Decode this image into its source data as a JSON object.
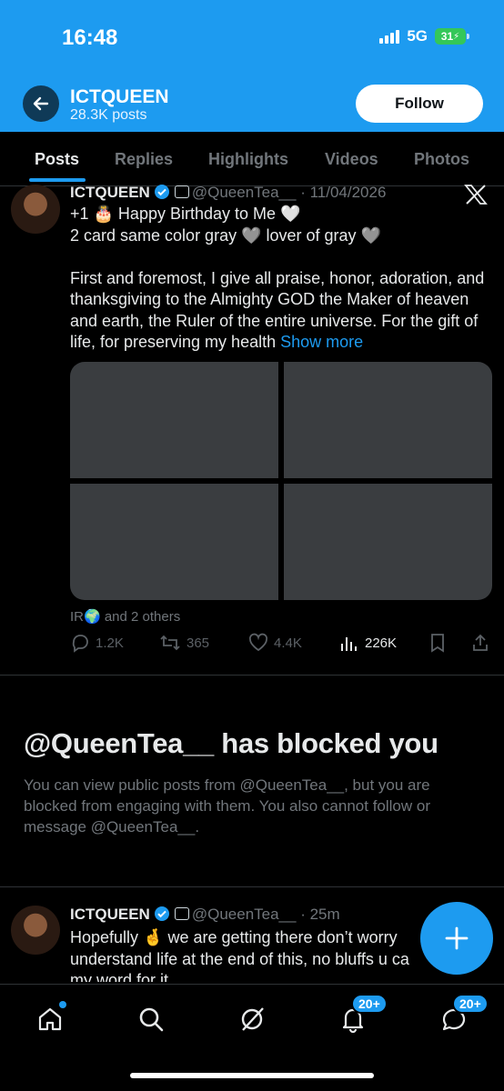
{
  "status_bar": {
    "time": "16:48",
    "network": "5G",
    "battery": "31"
  },
  "header": {
    "name": "ICTQUEEN",
    "posts_count": "28.3K posts",
    "follow_label": "Follow",
    "bg_color": "#1d9bf0"
  },
  "tabs": [
    "Posts",
    "Replies",
    "Highlights",
    "Videos",
    "Photos"
  ],
  "post1": {
    "name": "ICTQUEEN",
    "handle": "@QueenTea__",
    "date": "· 11/04/2026",
    "line1": "+1 🎂 Happy Birthday to Me 🤍",
    "line2": "2 card same color gray 🩶 lover of gray 🩶",
    "body": "First and foremost, I give all praise, honor, adoration, and thanksgiving to the Almighty GOD the Maker of heaven and earth, the Ruler of the entire universe. For the gift of life, for preserving my health",
    "show_more": "Show more",
    "liked_by": "IR🌍 and 2 others",
    "replies": "1.2K",
    "reposts": "365",
    "likes": "4.4K",
    "views": "226K"
  },
  "blocked": {
    "title": "@QueenTea__ has blocked you",
    "description": "You can view public posts from @QueenTea__, but you are blocked from engaging with them. You also cannot follow or message @QueenTea__."
  },
  "post2": {
    "name": "ICTQUEEN",
    "handle": "@QueenTea__",
    "time": "· 25m",
    "line1": "Hopefully 🤞 we are getting there don’t worry",
    "line2": "understand life at the end of this, no bluffs u ca",
    "line3": "my word for it"
  },
  "bottom_nav": {
    "notifications_badge": "20+",
    "messages_badge": "20+"
  }
}
